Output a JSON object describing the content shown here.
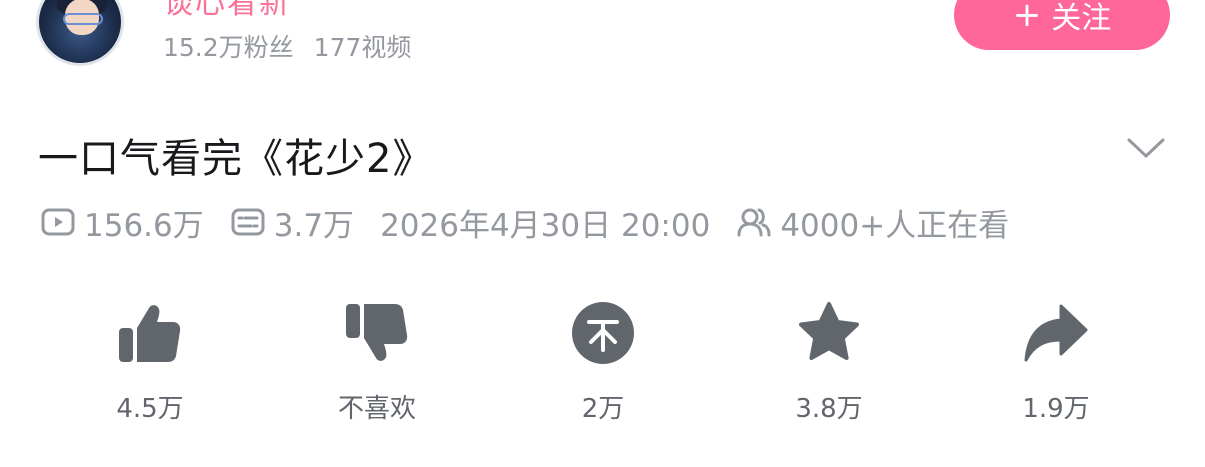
{
  "uploader": {
    "name": "谈心看新",
    "followers": "15.2万粉丝",
    "videos": "177视频",
    "follow_label": "关注"
  },
  "video": {
    "title": "一口气看完《花少2》",
    "views": "156.6万",
    "danmaku": "3.7万",
    "date": "2026年4月30日 20:00",
    "watching": "4000+人正在看"
  },
  "actions": [
    {
      "name": "like",
      "label": "4.5万"
    },
    {
      "name": "dislike",
      "label": "不喜欢"
    },
    {
      "name": "coin",
      "label": "2万"
    },
    {
      "name": "favorite",
      "label": "3.8万"
    },
    {
      "name": "share",
      "label": "1.9万"
    }
  ],
  "colors": {
    "accent": "#fb7299",
    "follow_bg": "#ff6699",
    "meta_gray": "#9499a0",
    "icon_gray": "#61666d"
  },
  "icons": [
    "avatar",
    "plus-icon",
    "chevron-down-icon",
    "play-count-icon",
    "danmaku-icon",
    "viewers-icon",
    "thumbs-up-icon",
    "thumbs-down-icon",
    "coin-icon",
    "star-icon",
    "share-icon"
  ]
}
